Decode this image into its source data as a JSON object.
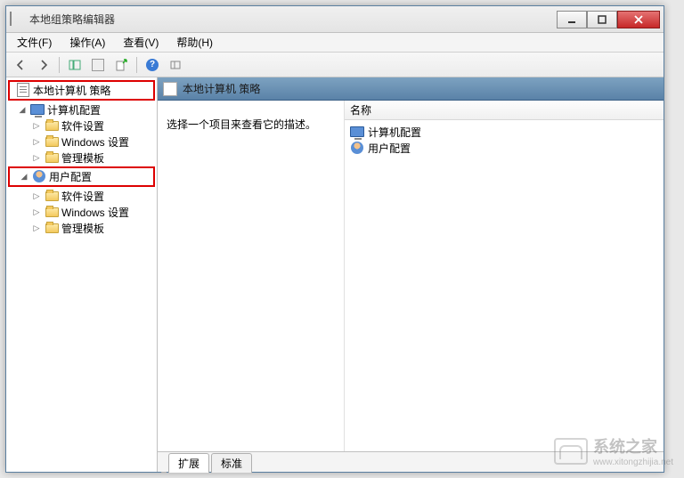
{
  "window": {
    "title": "本地组策略编辑器"
  },
  "menubar": [
    "文件(F)",
    "操作(A)",
    "查看(V)",
    "帮助(H)"
  ],
  "tree": {
    "root": "本地计算机 策略",
    "computer_cfg": "计算机配置",
    "user_cfg": "用户配置",
    "software": "软件设置",
    "windows": "Windows 设置",
    "templates": "管理模板"
  },
  "detail": {
    "header": "本地计算机 策略",
    "description": "选择一个项目来查看它的描述。",
    "column_name": "名称",
    "rows": [
      "计算机配置",
      "用户配置"
    ]
  },
  "tabs": {
    "extended": "扩展",
    "standard": "标准"
  },
  "watermark": {
    "brand": "系统之家",
    "url": "www.xitongzhijia.net"
  }
}
